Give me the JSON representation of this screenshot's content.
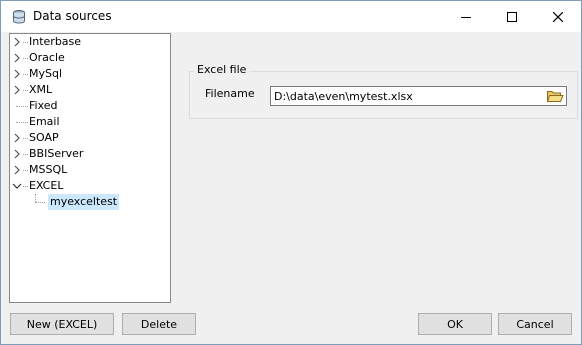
{
  "window": {
    "title": "Data sources"
  },
  "tree": {
    "items": [
      {
        "label": "Interbase",
        "expander": "chevron-right"
      },
      {
        "label": "Oracle",
        "expander": "chevron-right"
      },
      {
        "label": "MySql",
        "expander": "chevron-right"
      },
      {
        "label": "XML",
        "expander": "chevron-right"
      },
      {
        "label": "Fixed",
        "expander": "none"
      },
      {
        "label": "Email",
        "expander": "none"
      },
      {
        "label": "SOAP",
        "expander": "chevron-right"
      },
      {
        "label": "BBIServer",
        "expander": "chevron-right"
      },
      {
        "label": "MSSQL",
        "expander": "chevron-right"
      },
      {
        "label": "EXCEL",
        "expander": "chevron-down"
      }
    ],
    "child": {
      "label": "myexceltest"
    }
  },
  "excel_group": {
    "legend": "Excel file",
    "filename_label": "Filename",
    "filename_value": "D:\\data\\even\\mytest.xlsx"
  },
  "buttons": {
    "new": "New (EXCEL)",
    "delete": "Delete",
    "ok": "OK",
    "cancel": "Cancel"
  },
  "colors": {
    "selection": "#cce8ff",
    "border": "#828790",
    "button_face": "#e1e1e1"
  }
}
